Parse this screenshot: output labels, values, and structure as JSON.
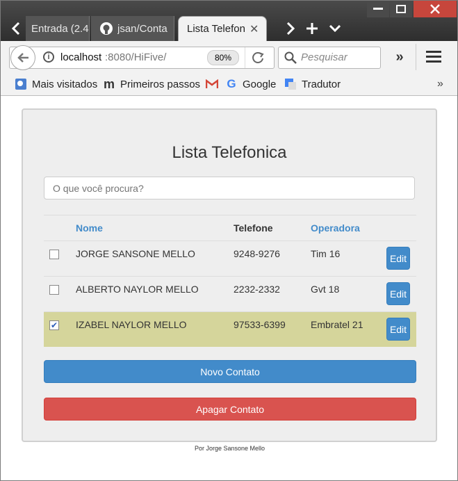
{
  "browser": {
    "tabs": [
      {
        "label": "Entrada (2.4"
      },
      {
        "label": "jsan/Conta"
      },
      {
        "label": "Lista Telefon"
      }
    ],
    "url_host": "localhost",
    "url_path": ":8080/HiFive/",
    "zoom": "80%",
    "search_placeholder": "Pesquisar",
    "bookmarks": [
      {
        "label": "Mais visitados"
      },
      {
        "label": "Primeiros passos"
      },
      {
        "label": "Google"
      },
      {
        "label": "Tradutor"
      }
    ]
  },
  "page": {
    "title": "Lista Telefonica",
    "search_placeholder": "O que você procura?",
    "columns": {
      "name": "Nome",
      "phone": "Telefone",
      "operator": "Operadora"
    },
    "rows": [
      {
        "name": "JORGE SANSONE MELLO",
        "phone": "9248-9276",
        "operator": "Tim 16",
        "checked": false,
        "edit": "Edit"
      },
      {
        "name": "ALBERTO NAYLOR MELLO",
        "phone": "2232-2332",
        "operator": "Gvt 18",
        "checked": false,
        "edit": "Edit"
      },
      {
        "name": "IZABEL NAYLOR MELLO",
        "phone": "97533-6399",
        "operator": "Embratel 21",
        "checked": true,
        "edit": "Edit"
      }
    ],
    "new_contact": "Novo Contato",
    "delete_contact": "Apagar Contato",
    "footer": "Por Jorge Sansone Mello"
  },
  "colors": {
    "primary": "#428bca",
    "danger": "#d9534f",
    "selected_row": "#d5d59b",
    "link_header": "#428bca"
  }
}
